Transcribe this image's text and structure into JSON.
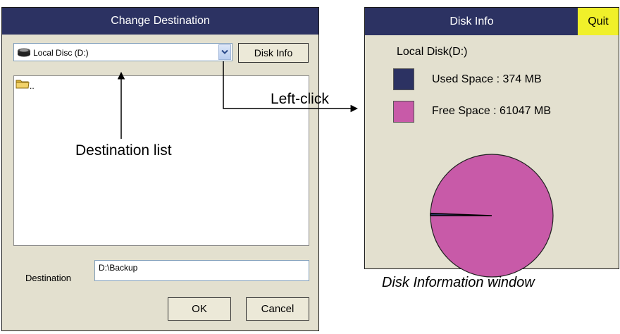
{
  "dialog": {
    "title": "Change Destination",
    "drive_select_value": "Local Disc (D:)",
    "disk_info_label": "Disk Info",
    "parent_folder_label": "..",
    "destination_label": "Destination",
    "destination_value": "D:\\Backup",
    "ok_label": "OK",
    "cancel_label": "Cancel"
  },
  "disk_info_window": {
    "title": "Disk Info",
    "quit_label": "Quit",
    "disk_name": "Local Disk(D:)",
    "used_label": "Used Space : 374 MB",
    "free_label": "Free Space : 61047 MB",
    "used_mb": 374,
    "free_mb": 61047,
    "used_color": "#2c3262",
    "free_color": "#c85aa8"
  },
  "annotations": {
    "destination_list": "Destination list",
    "left_click": "Left-click",
    "disk_info_window_caption": "Disk Information window"
  },
  "icons": [
    "drive-icon",
    "dropdown-arrow-icon",
    "folder-icon"
  ]
}
